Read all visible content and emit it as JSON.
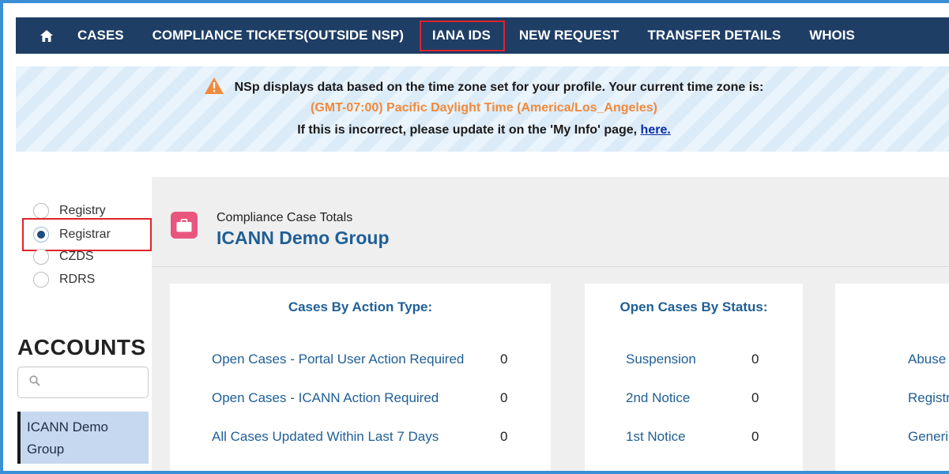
{
  "nav": {
    "home_icon": "home-icon",
    "items": [
      "CASES",
      "COMPLIANCE TICKETS(OUTSIDE NSP)",
      "IANA IDS",
      "NEW REQUEST",
      "TRANSFER DETAILS",
      "WHOIS"
    ]
  },
  "banner": {
    "warning_icon": "warning-icon",
    "line1": "NSp displays data based on the time zone set for your profile. Your current time zone is:",
    "line2": "(GMT-07:00) Pacific Daylight Time (America/Los_Angeles)",
    "line3_prefix": "If this is incorrect, please update it on the 'My Info' page, ",
    "line3_link": "here."
  },
  "sidebar": {
    "radios": [
      {
        "label": "Registry",
        "checked": false
      },
      {
        "label": "Registrar",
        "checked": true
      },
      {
        "label": "CZDS",
        "checked": false
      },
      {
        "label": "RDRS",
        "checked": false
      }
    ],
    "accounts_title": "ACCOUNTS",
    "search_icon": "search-icon",
    "account_items": [
      "ICANN Demo Group"
    ]
  },
  "main": {
    "header_icon": "briefcase-icon",
    "subtitle": "Compliance Case Totals",
    "title": "ICANN Demo Group",
    "cards": [
      {
        "title": "Cases By Action Type:",
        "rows": [
          {
            "label": "Open Cases - Portal User Action Required",
            "value": "0"
          },
          {
            "label": "Open Cases - ICANN Action Required",
            "value": "0"
          },
          {
            "label": "All Cases Updated Within Last 7 Days",
            "value": "0"
          }
        ]
      },
      {
        "title": "Open Cases By Status:",
        "rows": [
          {
            "label": "Suspension",
            "value": "0"
          },
          {
            "label": "2nd Notice",
            "value": "0"
          },
          {
            "label": "1st Notice",
            "value": "0"
          }
        ]
      },
      {
        "title": "",
        "rows": [
          {
            "label": "Abuse",
            "value": ""
          },
          {
            "label": "Registr",
            "value": ""
          },
          {
            "label": "Generi",
            "value": ""
          }
        ]
      }
    ]
  },
  "colors": {
    "nav_bg": "#1e3e66",
    "accent_blue": "#1f5f96",
    "highlight_red": "#e0232b",
    "timezone_orange": "#f08a3c"
  }
}
